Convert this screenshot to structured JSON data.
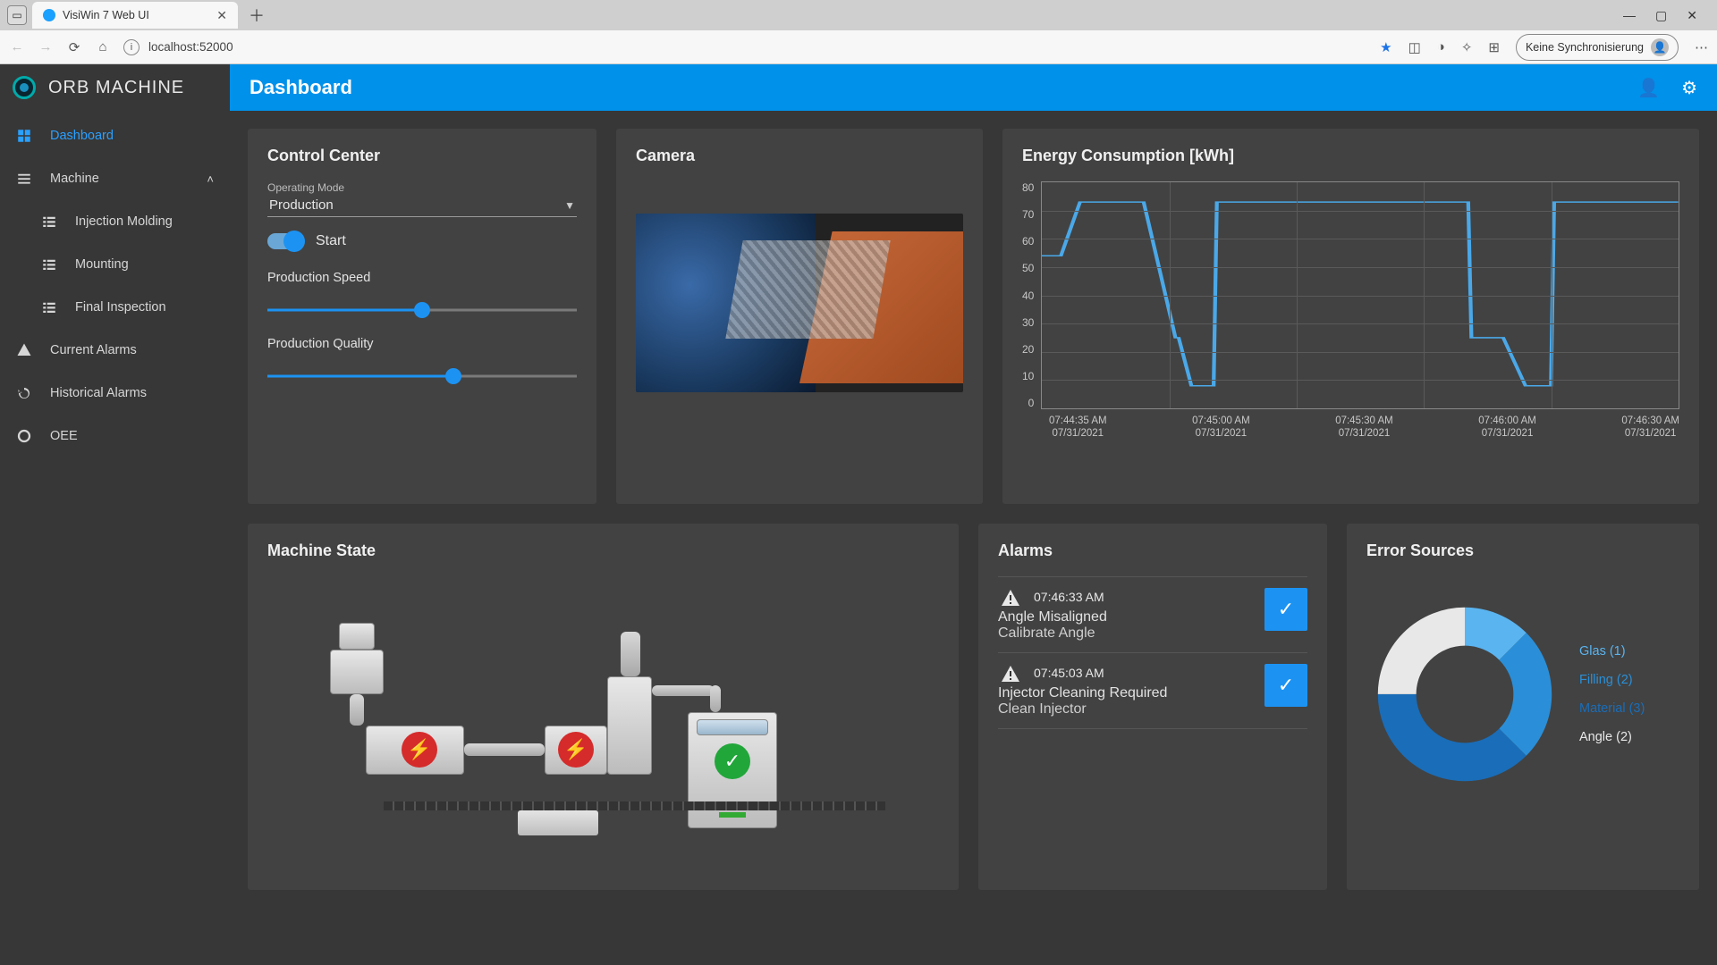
{
  "browser": {
    "tab_title": "VisiWin 7 Web UI",
    "url": "localhost:52000",
    "sync_label": "Keine Synchronisierung"
  },
  "brand": "ORB MACHINE",
  "page_title": "Dashboard",
  "sidebar": {
    "items": [
      {
        "label": "Dashboard",
        "active": true
      },
      {
        "label": "Machine",
        "expandable": true
      },
      {
        "label": "Injection Molding",
        "sub": true
      },
      {
        "label": "Mounting",
        "sub": true
      },
      {
        "label": "Final Inspection",
        "sub": true
      },
      {
        "label": "Current Alarms"
      },
      {
        "label": "Historical Alarms"
      },
      {
        "label": "OEE"
      }
    ]
  },
  "control_center": {
    "title": "Control Center",
    "op_mode_label": "Operating Mode",
    "op_mode_value": "Production",
    "start_label": "Start",
    "speed_label": "Production Speed",
    "speed_pct": 50,
    "quality_label": "Production Quality",
    "quality_pct": 60
  },
  "camera": {
    "title": "Camera"
  },
  "energy": {
    "title": "Energy Consumption [kWh]",
    "y_ticks": [
      80,
      70,
      60,
      50,
      40,
      30,
      20,
      10,
      0
    ],
    "x_ticks": [
      {
        "t": "07:44:35 AM",
        "d": "07/31/2021"
      },
      {
        "t": "07:45:00 AM",
        "d": "07/31/2021"
      },
      {
        "t": "07:45:30 AM",
        "d": "07/31/2021"
      },
      {
        "t": "07:46:00 AM",
        "d": "07/31/2021"
      },
      {
        "t": "07:46:30 AM",
        "d": "07/31/2021"
      }
    ]
  },
  "chart_data": {
    "type": "line",
    "title": "Energy Consumption [kWh]",
    "ylabel": "kWh",
    "ylim": [
      0,
      80
    ],
    "x": [
      0,
      0.03,
      0.06,
      0.09,
      0.13,
      0.16,
      0.21,
      0.215,
      0.235,
      0.24,
      0.27,
      0.275,
      0.49,
      0.495,
      0.67,
      0.675,
      0.72,
      0.725,
      0.76,
      0.765,
      0.8,
      0.805,
      1.0
    ],
    "values": [
      54,
      54,
      73,
      73,
      73,
      73,
      25,
      25,
      8,
      8,
      8,
      73,
      73,
      73,
      73,
      25,
      25,
      25,
      8,
      8,
      8,
      73,
      73
    ],
    "x_tick_labels": [
      "07:44:35 AM 07/31/2021",
      "07:45:00 AM 07/31/2021",
      "07:45:30 AM 07/31/2021",
      "07:46:00 AM 07/31/2021",
      "07:46:30 AM 07/31/2021"
    ]
  },
  "machine_state": {
    "title": "Machine State"
  },
  "alarms": {
    "title": "Alarms",
    "items": [
      {
        "time": "07:46:33 AM",
        "title": "Angle Misaligned",
        "sub": "Calibrate Angle"
      },
      {
        "time": "07:45:03 AM",
        "title": "Injector Cleaning Required",
        "sub": "Clean Injector"
      }
    ]
  },
  "error_sources": {
    "title": "Error Sources",
    "legend": [
      {
        "label": "Glas (1)",
        "value": 1,
        "color": "#5ab4f0"
      },
      {
        "label": "Filling (2)",
        "value": 2,
        "color": "#2a8fd8"
      },
      {
        "label": "Material (3)",
        "value": 3,
        "color": "#1a6db8"
      },
      {
        "label": "Angle (2)",
        "value": 2,
        "color": "#e8e8e8"
      }
    ]
  }
}
